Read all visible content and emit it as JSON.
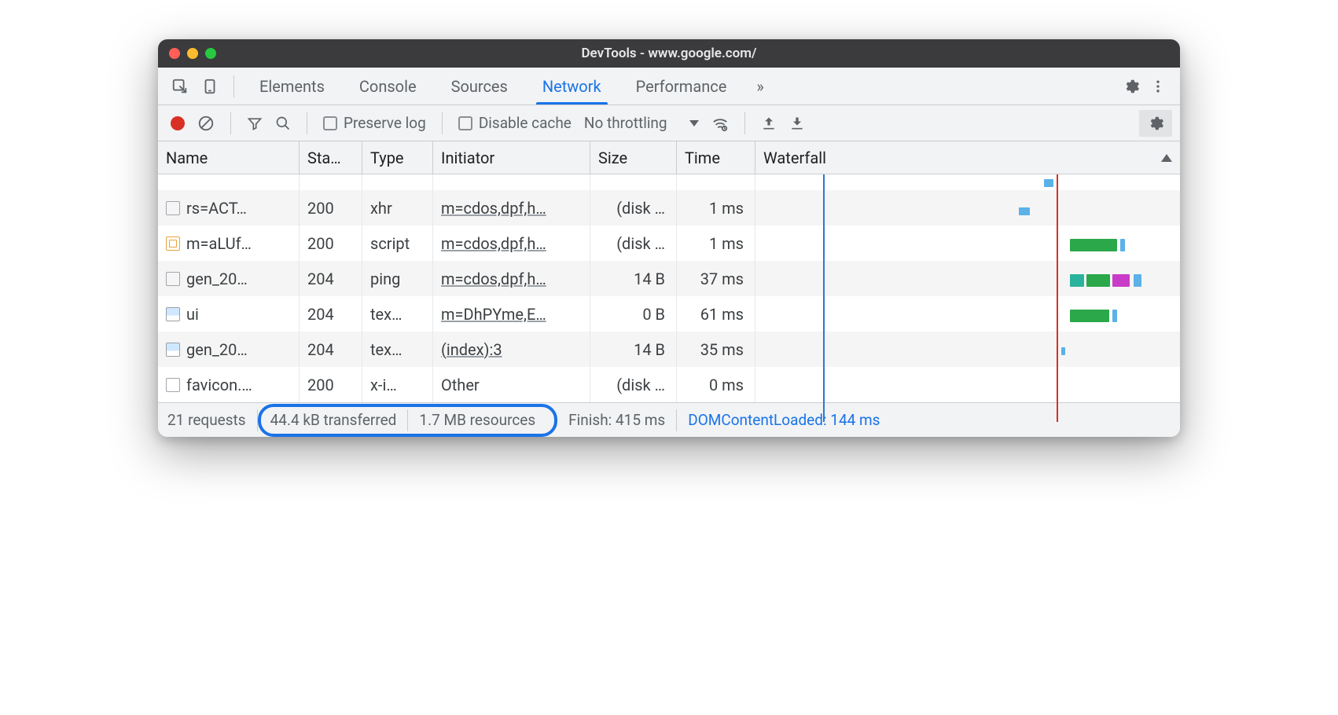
{
  "window": {
    "title": "DevTools - www.google.com/"
  },
  "tabs": {
    "items": [
      "Elements",
      "Console",
      "Sources",
      "Network",
      "Performance"
    ],
    "active": "Network",
    "overflow_glyph": "»"
  },
  "toolbar": {
    "preserve_log": "Preserve log",
    "disable_cache": "Disable cache",
    "throttling": "No throttling"
  },
  "columns": {
    "name": "Name",
    "status": "Sta…",
    "type": "Type",
    "initiator": "Initiator",
    "size": "Size",
    "time": "Time",
    "waterfall": "Waterfall"
  },
  "rows": [
    {
      "icon": "doc",
      "name": "rs=ACT…",
      "status": "200",
      "type": "xhr",
      "initiator": "m=cdos,dpf,h…",
      "size": "(disk …",
      "time": "1 ms"
    },
    {
      "icon": "script",
      "name": "m=aLUf…",
      "status": "200",
      "type": "script",
      "initiator": "m=cdos,dpf,h…",
      "size": "(disk …",
      "time": "1 ms"
    },
    {
      "icon": "doc",
      "name": "gen_20…",
      "status": "204",
      "type": "ping",
      "initiator": "m=cdos,dpf,h…",
      "size": "14 B",
      "time": "37 ms"
    },
    {
      "icon": "img",
      "name": "ui",
      "status": "204",
      "type": "tex…",
      "initiator": "m=DhPYme,E…",
      "size": "0 B",
      "time": "61 ms"
    },
    {
      "icon": "img",
      "name": "gen_20…",
      "status": "204",
      "type": "tex…",
      "initiator": "(index):3",
      "size": "14 B",
      "time": "35 ms"
    },
    {
      "icon": "doc",
      "name": "favicon.…",
      "status": "200",
      "type": "x-i…",
      "initiator": "Other",
      "size": "(disk …",
      "time": "0 ms"
    }
  ],
  "status": {
    "requests": "21 requests",
    "transferred": "44.4 kB transferred",
    "resources": "1.7 MB resources",
    "finish": "Finish: 415 ms",
    "dom": "DOMContentLoaded: 144 ms"
  }
}
